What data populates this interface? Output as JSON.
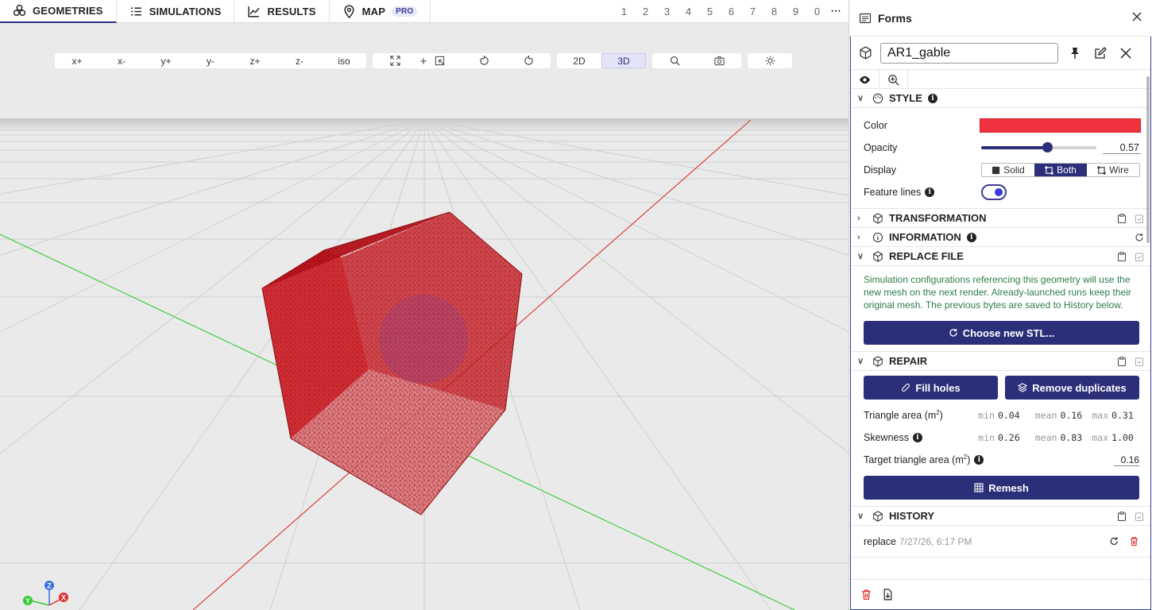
{
  "tabs": [
    {
      "label": "GEOMETRIES",
      "icon": "geometries-icon"
    },
    {
      "label": "SIMULATIONS",
      "icon": "list-icon"
    },
    {
      "label": "RESULTS",
      "icon": "chart-line-icon"
    },
    {
      "label": "MAP",
      "icon": "map-pin-icon",
      "badge": "PRO"
    }
  ],
  "slots": [
    "1",
    "2",
    "3",
    "4",
    "5",
    "6",
    "7",
    "8",
    "9",
    "0"
  ],
  "more": "⋯",
  "view_buttons": [
    "x+",
    "x-",
    "y+",
    "y-",
    "z+",
    "z-",
    "iso"
  ],
  "dim_buttons": {
    "two_d": "2D",
    "three_d": "3D",
    "active": "3D"
  },
  "add_label": "+",
  "gizmo": {
    "x": "X",
    "y": "Y",
    "z": "Z"
  },
  "forms": {
    "title": "Forms",
    "geometry_name": "AR1_gable",
    "style": {
      "title": "STYLE",
      "color_label": "Color",
      "color": "#ef3340",
      "opacity_label": "Opacity",
      "opacity": "0.57",
      "display_label": "Display",
      "display_options": [
        "Solid",
        "Both",
        "Wire"
      ],
      "display_selected": "Both",
      "feature_lines_label": "Feature lines",
      "feature_lines_on": true
    },
    "transformation_title": "TRANSFORMATION",
    "information_title": "INFORMATION",
    "replace": {
      "title": "REPLACE FILE",
      "note": "Simulation configurations referencing this geometry will use the new mesh on the next render. Already-launched runs keep their original mesh. The previous bytes are saved to History below.",
      "button": "Choose new STL..."
    },
    "repair": {
      "title": "REPAIR",
      "fill_holes": "Fill holes",
      "remove_duplicates": "Remove duplicates",
      "triangle_area_label": "Triangle area (m",
      "triangle_area_sup": "2",
      "triangle_area_suffix": ")",
      "skewness_label": "Skewness",
      "min_key": "min",
      "mean_key": "mean",
      "max_key": "max",
      "area_min": "0.04",
      "area_mean": "0.16",
      "area_max": "0.31",
      "skew_min": "0.26",
      "skew_mean": "0.83",
      "skew_max": "1.00",
      "target_label": "Target triangle area (m",
      "target_sup": "2",
      "target_suffix": ")",
      "target_value": "0.16",
      "remesh": "Remesh"
    },
    "history": {
      "title": "HISTORY",
      "action": "replace",
      "timestamp": "7/27/26, 6:17 PM"
    }
  },
  "colors": {
    "accent": "#2b2f7a",
    "mesh": "#d62828",
    "x_axis": "#e03030",
    "y_axis": "#33cc33",
    "z_axis": "#3a6ee0"
  }
}
